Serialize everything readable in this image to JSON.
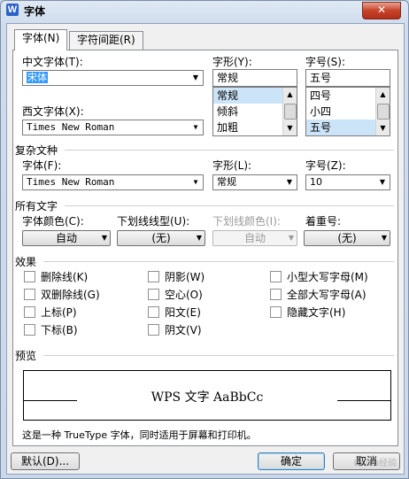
{
  "window": {
    "title": "字体",
    "app_icon_letter": "W",
    "close_glyph": "✕"
  },
  "tabs": [
    {
      "label": "字体(N)"
    },
    {
      "label": "字符间距(R)"
    }
  ],
  "font": {
    "chinese_label": "中文字体(T):",
    "chinese_value": "宋体",
    "western_label": "西文字体(X):",
    "western_value": "Times New Roman",
    "style_label": "字形(Y):",
    "style_value": "常规",
    "style_options": [
      "常规",
      "倾斜",
      "加粗"
    ],
    "style_selected": "常规",
    "size_label": "字号(S):",
    "size_value": "五号",
    "size_options": [
      "四号",
      "小四",
      "五号"
    ],
    "size_selected": "五号"
  },
  "complex": {
    "section": "复杂文种",
    "font_label": "字体(F):",
    "font_value": "Times New Roman",
    "style_label": "字形(L):",
    "style_value": "常规",
    "size_label": "字号(Z):",
    "size_value": "10"
  },
  "all_text": {
    "section": "所有文字",
    "color_label": "字体颜色(C):",
    "color_value": "自动",
    "underline_label": "下划线线型(U):",
    "underline_value": "(无)",
    "underline_color_label": "下划线颜色(I):",
    "underline_color_value": "自动",
    "emphasis_label": "着重号:",
    "emphasis_value": "(无)"
  },
  "effects": {
    "section": "效果",
    "items": [
      {
        "label": "删除线(K)"
      },
      {
        "label": "双删除线(G)"
      },
      {
        "label": "上标(P)"
      },
      {
        "label": "下标(B)"
      },
      {
        "label": "阴影(W)"
      },
      {
        "label": "空心(O)"
      },
      {
        "label": "阳文(E)"
      },
      {
        "label": "阴文(V)"
      },
      {
        "label": "小型大写字母(M)"
      },
      {
        "label": "全部大写字母(A)"
      },
      {
        "label": "隐藏文字(H)"
      }
    ]
  },
  "preview": {
    "section": "预览",
    "sample": "WPS 文字 AaBbCc",
    "note": "这是一种 TrueType 字体，同时适用于屏幕和打印机。"
  },
  "buttons": {
    "default": "默认(D)...",
    "ok": "确定",
    "cancel": "取消"
  },
  "watermark": "Baidu经验"
}
